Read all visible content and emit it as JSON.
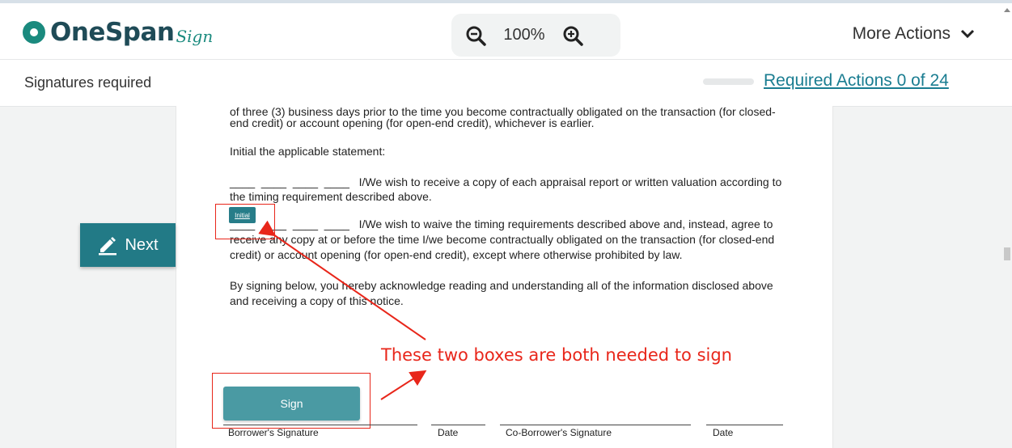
{
  "header": {
    "logo_text": "OneSpan",
    "logo_sub": "Sign",
    "zoom_value": "100%",
    "zoom_out_icon": "zoom-out-icon",
    "zoom_in_icon": "zoom-in-icon",
    "more_actions_label": "More Actions"
  },
  "subbar": {
    "signatures_required": "Signatures required",
    "required_actions": "Required Actions 0 of 24",
    "progress": 0
  },
  "navigation": {
    "next_label": "Next"
  },
  "document": {
    "line_top_partial": "of three (3) business days prior to the time you become contractually obligated on the transaction (for closed-",
    "line_top_2": "end credit) or account opening (for open-end credit), whichever is earlier.",
    "initial_statement": "Initial the applicable statement:",
    "option1_line1": "____  ____  ____  ____   I/We wish to receive a copy of each appraisal report or written valuation according to",
    "option1_line2": "the timing requirement described above.",
    "option2_line1": "____  ____  ____  ____   I/We wish to waive the timing requirements described above and, instead, agree to",
    "option2_line2": "receive any copy at or before the time I/we become contractually obligated on the transaction (for closed-end",
    "option2_line3": "credit) or account opening (for open-end credit), except where otherwise prohibited by law.",
    "ack_line1": "By signing below, you hereby acknowledge reading and understanding all of the information disclosed above",
    "ack_line2": "and receiving a copy of this notice.",
    "initial_button": "Initial",
    "sign_button": "Sign",
    "sig_labels": [
      "Borrower's Signature",
      "Date",
      "Co-Borrower's Signature",
      "Date"
    ]
  },
  "annotation": {
    "text": "These two boxes are both needed to sign",
    "color": "#e8261a"
  },
  "colors": {
    "brand": "#1a8a7e",
    "accent_link": "#1a7d91",
    "button": "#227a86"
  }
}
